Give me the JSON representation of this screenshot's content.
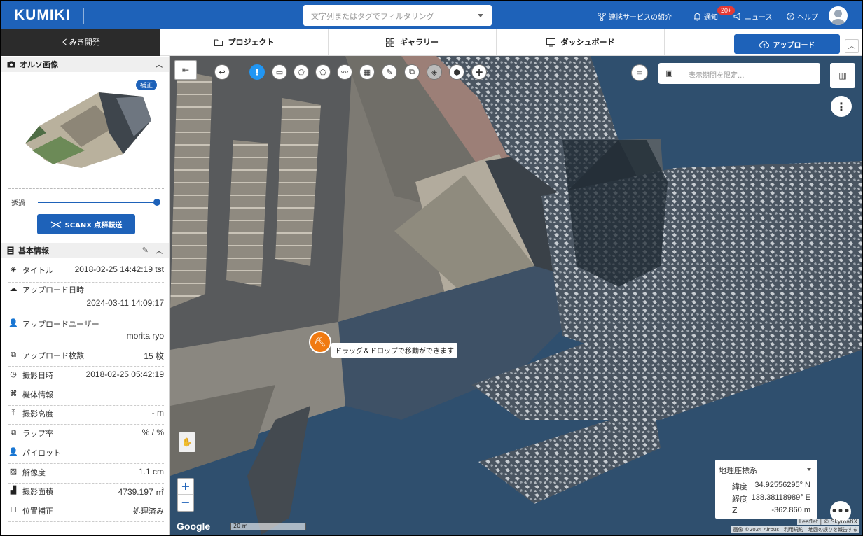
{
  "header": {
    "logo": "KUMIKI",
    "search_placeholder": "文字列またはタグでフィルタリング",
    "links": {
      "services": "連携サービスの紹介",
      "notifications": "通知",
      "news": "ニュース",
      "help": "ヘルプ"
    },
    "notification_badge": "20+"
  },
  "nav": {
    "project_name": "くみき開発",
    "tabs": [
      "プロジェクト",
      "ギャラリー",
      "ダッシュボード"
    ],
    "upload_label": "アップロード"
  },
  "sidebar": {
    "ortho_title": "オルソ画像",
    "correction_badge": "補正",
    "transparency_label": "透過",
    "transparency_value": 1.0,
    "scanx_button": "SCANX 点群転送",
    "basic_info_title": "基本情報",
    "rows": [
      {
        "icon": "layers-icon",
        "label": "タイトル",
        "value": "2018-02-25 14:42:19 tst"
      },
      {
        "icon": "upload-cloud-icon",
        "label": "アップロード日時",
        "value": "2024-03-11 14:09:17"
      },
      {
        "icon": "person-icon",
        "label": "アップロードユーザー",
        "value": "morita ryo"
      },
      {
        "icon": "image-stack-icon",
        "label": "アップロード枚数",
        "value": "15 枚"
      },
      {
        "icon": "clock-icon",
        "label": "撮影日時",
        "value": "2018-02-25 05:42:19"
      },
      {
        "icon": "drone-icon",
        "label": "機体情報",
        "value": ""
      },
      {
        "icon": "altitude-icon",
        "label": "撮影高度",
        "value": "- m"
      },
      {
        "icon": "overlap-icon",
        "label": "ラップ率",
        "value": "% / %"
      },
      {
        "icon": "pilot-icon",
        "label": "パイロット",
        "value": ""
      },
      {
        "icon": "resolution-icon",
        "label": "解像度",
        "value": "1.1 cm"
      },
      {
        "icon": "area-icon",
        "label": "撮影面積",
        "value": "4739.197 ㎡"
      },
      {
        "icon": "correction-icon",
        "label": "位置補正",
        "value": "処理済み"
      }
    ]
  },
  "map": {
    "date_filter_placeholder": "表示期間を限定...",
    "drag_tooltip": "ドラッグ＆ドロップで移動ができます",
    "google_label": "Google",
    "scale_label": "20 m",
    "coords": {
      "system": "地理座標系",
      "lat_label": "緯度",
      "lat": "34.92556295° N",
      "lon_label": "経度",
      "lon": "138.38118989° E",
      "z_label": "Z",
      "z": "-362.860 m"
    },
    "attribution_1": "Leaflet | © SkymatiX",
    "attribution_2": "画像 ©2024 Airbus　利用規約　地図の誤りを報告する"
  },
  "colors": {
    "brand_blue": "#1e62b9",
    "drag_orange": "#f07a12"
  }
}
